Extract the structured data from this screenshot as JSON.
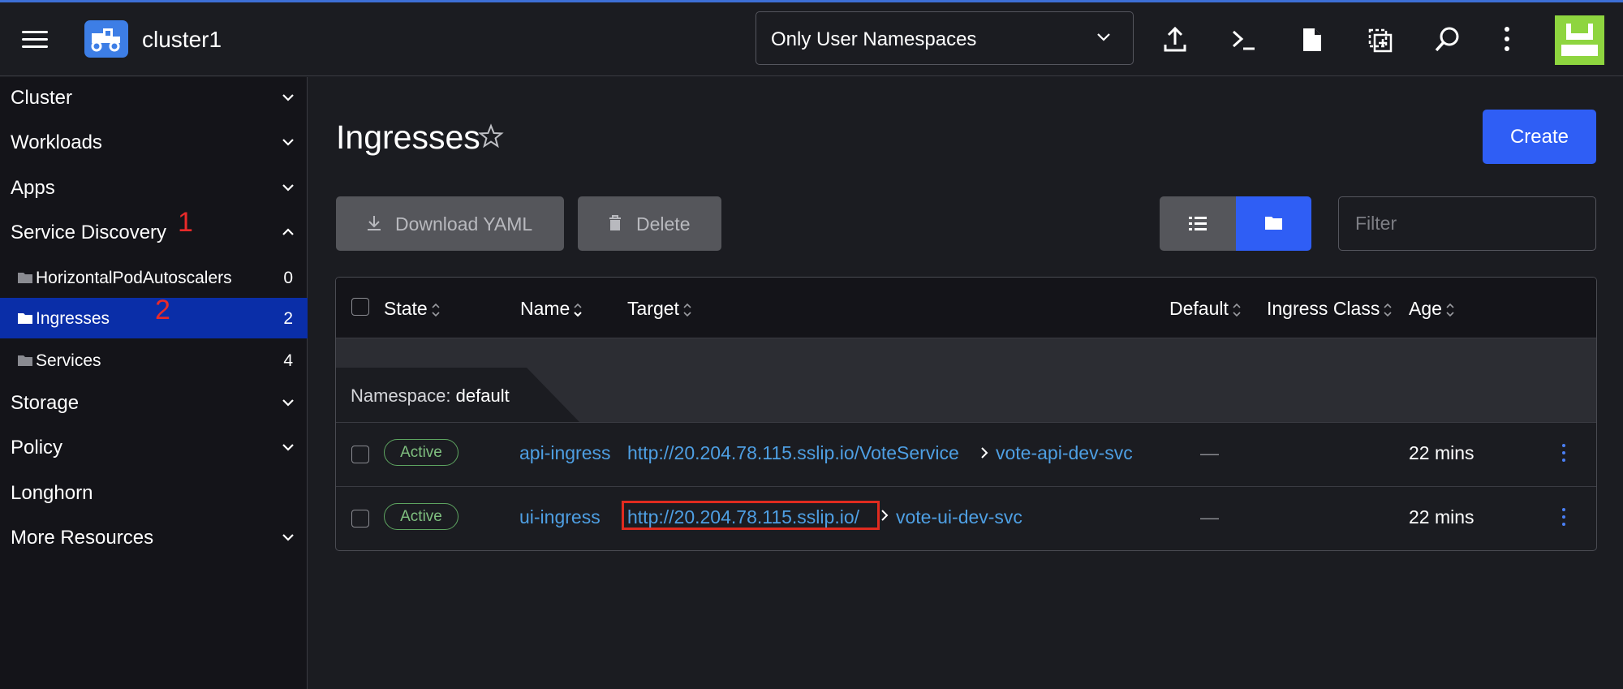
{
  "header": {
    "cluster_name": "cluster1",
    "namespace_filter": "Only User Namespaces"
  },
  "sidebar": {
    "groups": {
      "cluster": "Cluster",
      "workloads": "Workloads",
      "apps": "Apps",
      "service_discovery": "Service Discovery",
      "storage": "Storage",
      "policy": "Policy",
      "longhorn": "Longhorn",
      "more_resources": "More Resources"
    },
    "items": [
      {
        "label": "HorizontalPodAutoscalers",
        "count": "0"
      },
      {
        "label": "Ingresses",
        "count": "2"
      },
      {
        "label": "Services",
        "count": "4"
      }
    ],
    "annotations": {
      "one": "1",
      "two": "2"
    }
  },
  "main": {
    "title": "Ingresses",
    "create_label": "Create",
    "download_yaml_label": "Download YAML",
    "delete_label": "Delete",
    "filter_placeholder": "Filter"
  },
  "table": {
    "headers": {
      "state": "State",
      "name": "Name",
      "target": "Target",
      "default": "Default",
      "ingress_class": "Ingress Class",
      "age": "Age"
    },
    "group": {
      "label": "Namespace:",
      "value": "default"
    },
    "rows": [
      {
        "state": "Active",
        "name": "api-ingress",
        "target_url": "http://20.204.78.115.sslip.io/VoteService",
        "target_service": "vote-api-dev-svc",
        "default": "—",
        "age": "22 mins"
      },
      {
        "state": "Active",
        "name": "ui-ingress",
        "target_url": "http://20.204.78.115.sslip.io/",
        "target_service": "vote-ui-dev-svc",
        "default": "—",
        "age": "22 mins"
      }
    ]
  },
  "colors": {
    "accent": "#2f5ef5",
    "active_nav": "#0a2ea8",
    "link": "#4e9fe3",
    "active_badge": "#5ea561",
    "highlight": "#e02b1f"
  }
}
